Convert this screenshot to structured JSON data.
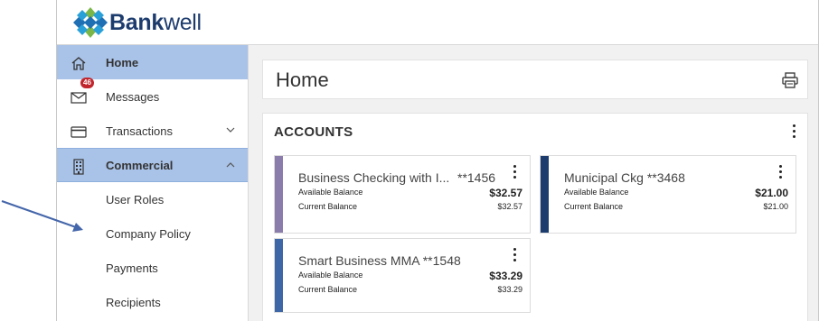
{
  "brand": {
    "name_bold": "Bank",
    "name_light": "well"
  },
  "sidebar": {
    "items": [
      {
        "label": "Home",
        "icon": "home-icon"
      },
      {
        "label": "Messages",
        "icon": "envelope-icon",
        "badge": "46"
      },
      {
        "label": "Transactions",
        "icon": "card-icon",
        "chevron": "down"
      },
      {
        "label": "Commercial",
        "icon": "building-icon",
        "chevron": "up"
      },
      {
        "label": "User Roles"
      },
      {
        "label": "Company Policy"
      },
      {
        "label": "Payments"
      },
      {
        "label": "Recipients"
      }
    ]
  },
  "main": {
    "title": "Home",
    "accounts": {
      "heading": "ACCOUNTS",
      "labels": {
        "available": "Available Balance",
        "current": "Current Balance"
      },
      "tiles": [
        {
          "name": "Business Checking with I...",
          "number": "**1456",
          "available": "$32.57",
          "current": "$32.57",
          "color": "#8b7dab"
        },
        {
          "name": "Municipal Ckg",
          "number": "**3468",
          "available": "$21.00",
          "current": "$21.00",
          "color": "#1d3c6e"
        },
        {
          "name": "Smart Business MMA",
          "number": "**1548",
          "available": "$33.29",
          "current": "$33.29",
          "color": "#3e67a8"
        }
      ]
    }
  },
  "colors": {
    "accent": "#a9c2e7",
    "brand": "#1d3c6e",
    "badge": "#c1262d",
    "arrow": "#4466aa"
  }
}
